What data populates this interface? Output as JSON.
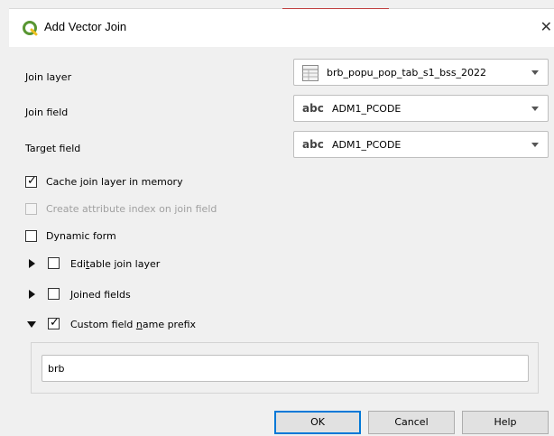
{
  "window": {
    "title": "Add Vector Join",
    "close_glyph": "✕"
  },
  "form": {
    "join_layer_label": "Join layer",
    "join_layer_value": "brb_popu_pop_tab_s1_bss_2022",
    "join_field_label": "Join field",
    "join_field_type": "abc",
    "join_field_value": "ADM1_PCODE",
    "target_field_label": "Target field",
    "target_field_type": "abc",
    "target_field_value": "ADM1_PCODE"
  },
  "options": {
    "cache": {
      "label": "Cache join layer in memory",
      "checked": true
    },
    "attr_index": {
      "label": "Create attribute index on join field",
      "checked": false,
      "enabled": false
    },
    "dynamic_form": {
      "label": "Dynamic form",
      "checked": false
    },
    "editable": {
      "label_pre": "Edi",
      "label_u": "t",
      "label_post": "able join layer",
      "checked": false,
      "expanded": false
    },
    "joined_fields": {
      "label_u": "J",
      "label_post": "oined fields",
      "checked": false,
      "expanded": false
    },
    "prefix": {
      "label_pre": "Custom field ",
      "label_u": "n",
      "label_post": "ame prefix",
      "checked": true,
      "expanded": true,
      "value": "brb"
    }
  },
  "buttons": {
    "ok": "OK",
    "cancel": "Cancel",
    "help": "Help"
  },
  "colors": {
    "qgis_green": "#589632",
    "focus_blue": "#0078d7"
  },
  "icons": {
    "app": "qgis-logo-icon",
    "layer": "table-layer-icon",
    "field_type": "text-field-icon"
  }
}
